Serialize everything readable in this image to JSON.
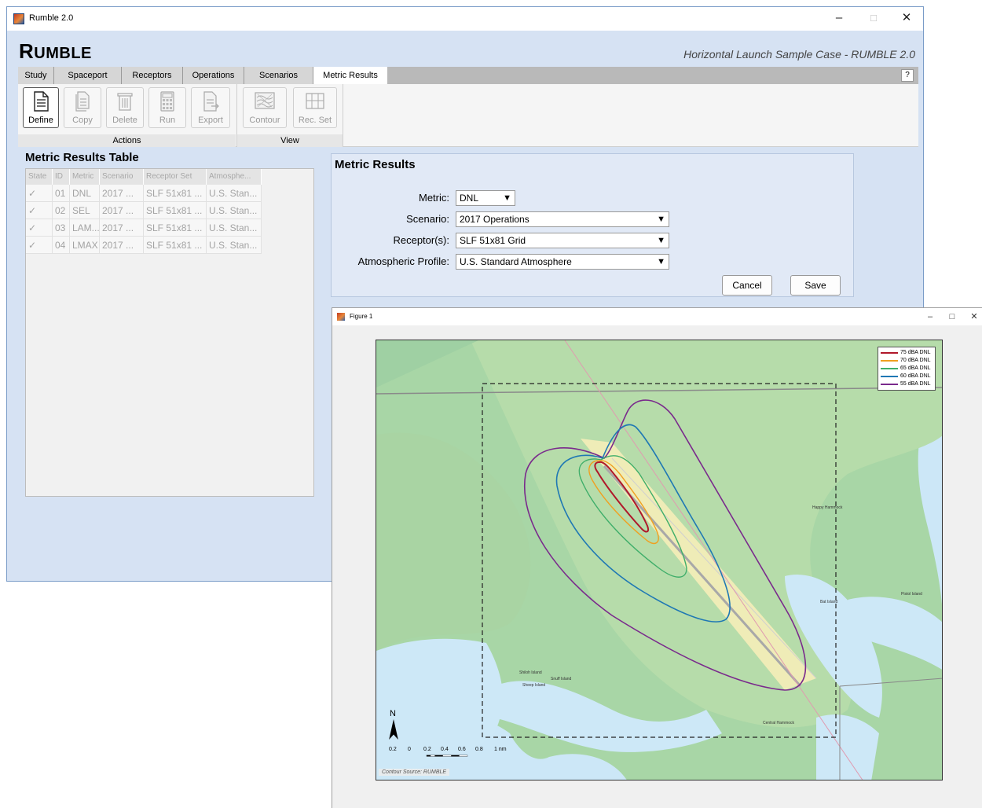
{
  "main_window": {
    "title": "Rumble 2.0",
    "controls": {
      "minimize": "–",
      "maximize": "□",
      "close": "✕"
    },
    "brand_first": "R",
    "brand_rest": "UMBLE",
    "case_title": "Horizontal Launch Sample Case - RUMBLE 2.0"
  },
  "tabs": [
    {
      "label": "Study"
    },
    {
      "label": "Spaceport"
    },
    {
      "label": "Receptors"
    },
    {
      "label": "Operations"
    },
    {
      "label": "Scenarios"
    },
    {
      "label": "Metric Results",
      "active": true
    }
  ],
  "help_label": "?",
  "toolbar": {
    "actions_label": "Actions",
    "view_label": "View",
    "define": "Define",
    "copy": "Copy",
    "delete": "Delete",
    "run": "Run",
    "export": "Export",
    "contour": "Contour",
    "rec_set": "Rec. Set"
  },
  "table": {
    "title": "Metric Results Table",
    "headers": [
      "State",
      "ID",
      "Metric",
      "Scenario",
      "Receptor Set",
      "Atmosphe..."
    ],
    "rows": [
      {
        "state": "✓",
        "id": "01",
        "metric": "DNL",
        "scenario": "2017 ...",
        "receptor_set": "SLF 51x81 ...",
        "atmosphere": "U.S. Stan..."
      },
      {
        "state": "✓",
        "id": "02",
        "metric": "SEL",
        "scenario": "2017 ...",
        "receptor_set": "SLF 51x81 ...",
        "atmosphere": "U.S. Stan..."
      },
      {
        "state": "✓",
        "id": "03",
        "metric": "LAM...",
        "scenario": "2017 ...",
        "receptor_set": "SLF 51x81 ...",
        "atmosphere": "U.S. Stan..."
      },
      {
        "state": "✓",
        "id": "04",
        "metric": "LMAX",
        "scenario": "2017 ...",
        "receptor_set": "SLF 51x81 ...",
        "atmosphere": "U.S. Stan..."
      }
    ]
  },
  "panel": {
    "title": "Metric Results",
    "metric_label": "Metric:",
    "metric_value": "DNL",
    "scenario_label": "Scenario:",
    "scenario_value": "2017 Operations",
    "receptor_label": "Receptor(s):",
    "receptor_value": "SLF 51x81 Grid",
    "atmos_label": "Atmospheric Profile:",
    "atmos_value": "U.S. Standard Atmosphere",
    "cancel": "Cancel",
    "save": "Save",
    "dropdown_arrow": "▼"
  },
  "figure": {
    "title": "Figure 1",
    "controls": {
      "minimize": "–",
      "maximize": "□",
      "close": "✕"
    },
    "legend": [
      {
        "label": "75 dBA DNL",
        "color": "#b0182a"
      },
      {
        "label": "70 dBA DNL",
        "color": "#f0a020"
      },
      {
        "label": "65 dBA DNL",
        "color": "#3fae6a"
      },
      {
        "label": "60 dBA DNL",
        "color": "#1f78b4"
      },
      {
        "label": "55 dBA DNL",
        "color": "#7a2a8c"
      }
    ],
    "north": "N",
    "scale_labels": [
      "0.2",
      "0",
      "0.2",
      "0.4",
      "0.6",
      "0.8",
      "1 nm"
    ],
    "contour_source": "Contour Source: RUMBLE",
    "map_labels": [
      "Happy Hammock",
      "Bat Island",
      "Pistol Island",
      "Shiloh Island",
      "Snuff Island",
      "Sheep Island",
      "Central Hammock"
    ]
  }
}
